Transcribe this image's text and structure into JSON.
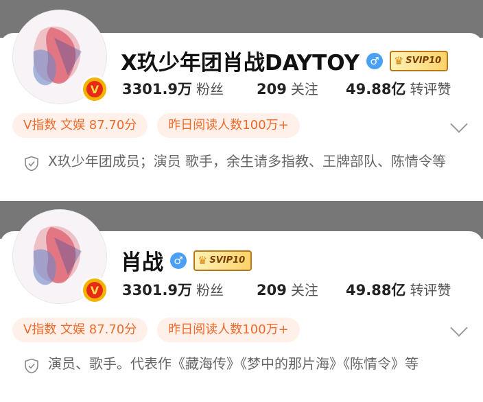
{
  "profiles": [
    {
      "name": "X玖少年团肖战DAYTOY",
      "gender_icon": "male-icon",
      "svip_label": "SVIP10",
      "fans_count": "3301.9万",
      "fans_label": "粉丝",
      "following_count": "209",
      "following_label": "关注",
      "likes_count": "49.88亿",
      "likes_label": "转评赞",
      "pill_index": "V指数 文娱 87.70分",
      "pill_reads": "昨日阅读人数100万+",
      "bio": "X玖少年团成员；演员 歌手，余生请多指教、王牌部队、陈情令等"
    },
    {
      "name": "肖战",
      "gender_icon": "male-icon",
      "svip_label": "SVIP10",
      "fans_count": "3301.9万",
      "fans_label": "粉丝",
      "following_count": "209",
      "following_label": "关注",
      "likes_count": "49.88亿",
      "likes_label": "转评赞",
      "pill_index": "V指数 文娱 87.70分",
      "pill_reads": "昨日阅读人数100万+",
      "bio": "演员、歌手。代表作《藏海传》《梦中的那片海》《陈情令》等"
    }
  ],
  "colors": {
    "accent_orange": "#f06a2a",
    "pill_bg": "#fff1ea",
    "verified_blue": "#4aa0f5"
  }
}
